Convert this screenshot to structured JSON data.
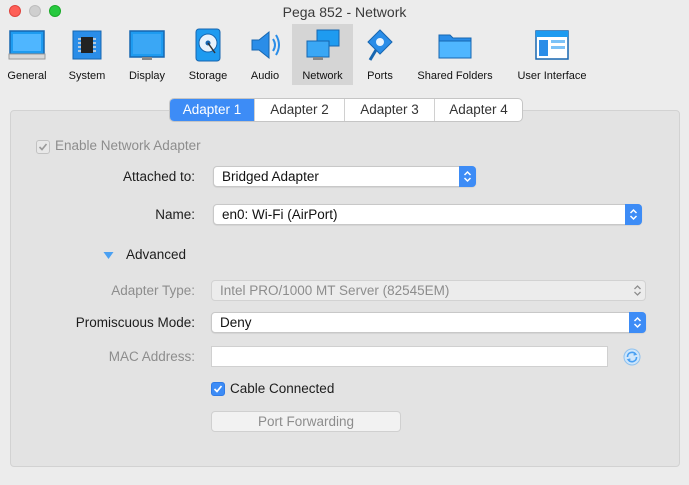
{
  "window": {
    "title": "Pega 852 - Network"
  },
  "toolbar": {
    "items": [
      {
        "label": "General",
        "icon": "general-icon"
      },
      {
        "label": "System",
        "icon": "chip-icon"
      },
      {
        "label": "Display",
        "icon": "monitor-icon"
      },
      {
        "label": "Storage",
        "icon": "disk-icon"
      },
      {
        "label": "Audio",
        "icon": "speaker-icon"
      },
      {
        "label": "Network",
        "icon": "network-icon",
        "active": true
      },
      {
        "label": "Ports",
        "icon": "ports-icon"
      },
      {
        "label": "Shared Folders",
        "icon": "folder-icon"
      },
      {
        "label": "User Interface",
        "icon": "window-icon"
      }
    ]
  },
  "tabs": {
    "items": [
      {
        "label": "Adapter 1",
        "active": true
      },
      {
        "label": "Adapter 2"
      },
      {
        "label": "Adapter 3"
      },
      {
        "label": "Adapter 4"
      }
    ]
  },
  "form": {
    "enable_adapter": {
      "label": "Enable Network Adapter",
      "checked": true,
      "disabled": true
    },
    "attached_to": {
      "label": "Attached to:",
      "value": "Bridged Adapter"
    },
    "name": {
      "label": "Name:",
      "value": "en0: Wi-Fi (AirPort)"
    },
    "advanced": {
      "label": "Advanced",
      "expanded": true
    },
    "adapter_type": {
      "label": "Adapter Type:",
      "value": "Intel PRO/1000 MT Server (82545EM)",
      "disabled": true
    },
    "promiscuous": {
      "label": "Promiscuous Mode:",
      "value": "Deny"
    },
    "mac_address": {
      "label": "MAC Address:",
      "value": "",
      "disabled": true
    },
    "cable_connected": {
      "label": "Cable Connected",
      "checked": true
    },
    "port_forwarding": {
      "label": "Port Forwarding",
      "disabled": true
    }
  },
  "colors": {
    "accent": "#3d8cf6",
    "active_tab": "#3d8cf6",
    "toolbar_active": "#d5d5d5"
  }
}
